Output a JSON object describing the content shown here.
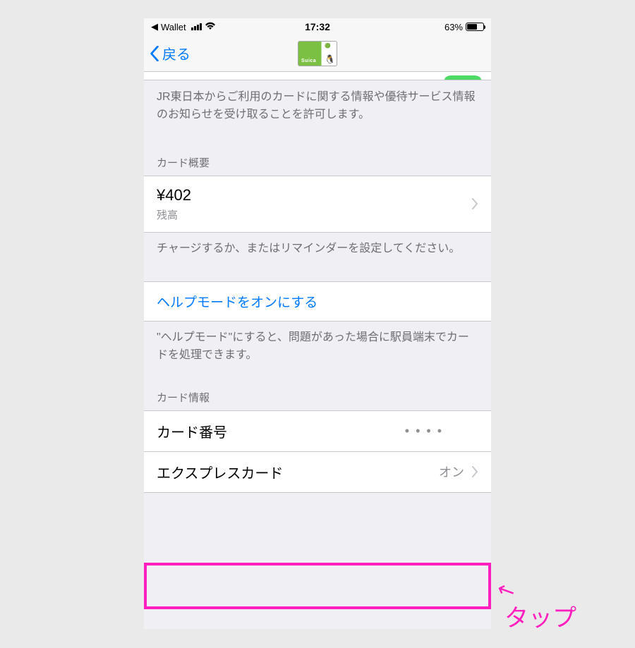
{
  "status": {
    "back_app": "Wallet",
    "time": "17:32",
    "battery_pct": "63%"
  },
  "nav": {
    "back_label": "戻る",
    "card_brand": "Suica"
  },
  "sections": {
    "notice_footer": "JR東日本からご利用のカードに関する情報や優待サービス情報のお知らせを受け取ることを許可します。",
    "overview_header": "カード概要",
    "balance_amount": "¥402",
    "balance_label": "残高",
    "overview_footer": "チャージするか、またはリマインダーを設定してください。",
    "help_mode_label": "ヘルプモードをオンにする",
    "help_mode_footer": "\"ヘルプモード\"にすると、問題があった場合に駅員端末でカードを処理できます。",
    "card_info_header": "カード情報",
    "card_number_label": "カード番号",
    "card_number_value": "• • • •",
    "express_card_label": "エクスプレスカード",
    "express_card_value": "オン"
  },
  "annotation": {
    "tap_label": "タップ"
  }
}
